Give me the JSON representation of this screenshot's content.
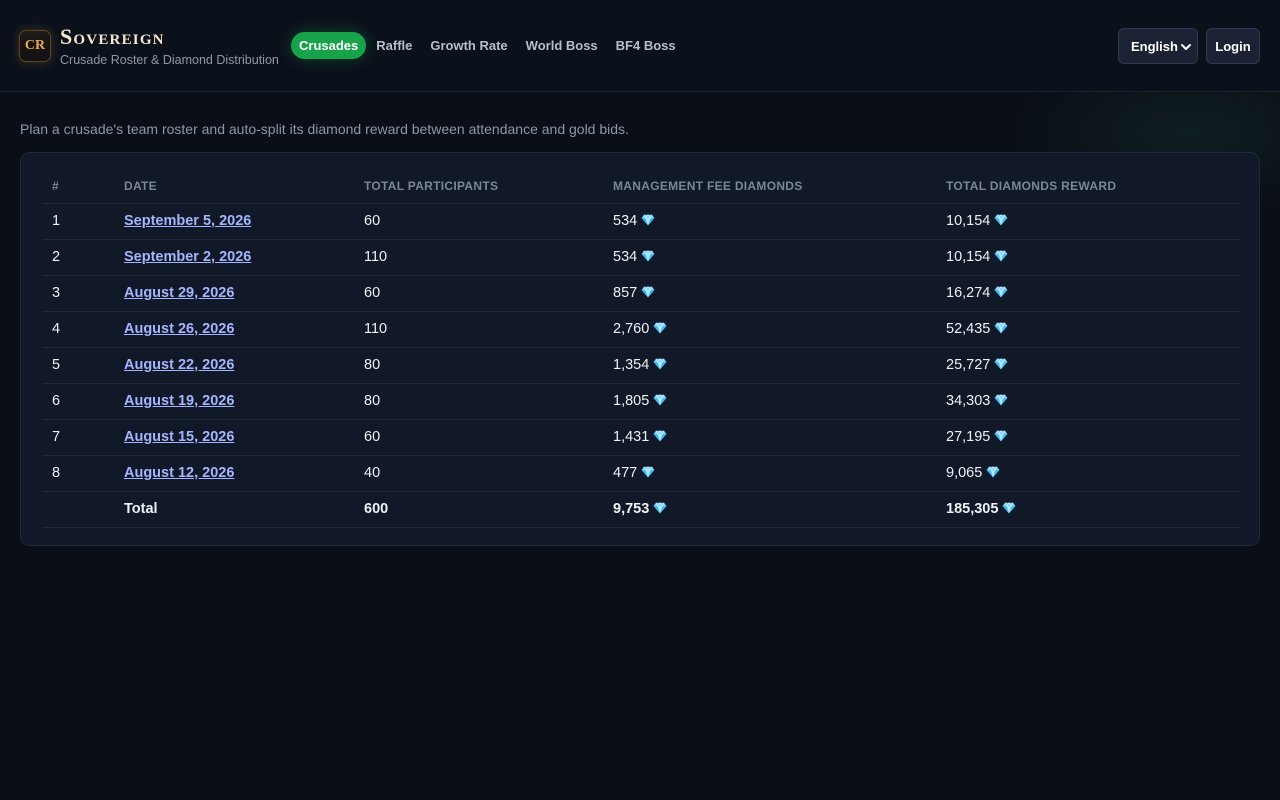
{
  "brand": {
    "badge": "CR",
    "title": "Sovereign",
    "subtitle": "Crusade Roster & Diamond Distribution"
  },
  "nav": [
    {
      "label": "Crusades",
      "active": true
    },
    {
      "label": "Raffle",
      "active": false
    },
    {
      "label": "Growth Rate",
      "active": false
    },
    {
      "label": "World Boss",
      "active": false
    },
    {
      "label": "BF4 Boss",
      "active": false
    }
  ],
  "language": {
    "selected": "English"
  },
  "login_label": "Login",
  "intro": "Plan a crusade's team roster and auto-split its diamond reward between attendance and gold bids.",
  "table": {
    "headers": [
      "#",
      "DATE",
      "TOTAL PARTICIPANTS",
      "MANAGEMENT FEE DIAMONDS",
      "TOTAL DIAMONDS REWARD"
    ],
    "rows": [
      {
        "n": "1",
        "date": "September 5, 2026",
        "participants": "60",
        "fee": "534",
        "reward": "10,154"
      },
      {
        "n": "2",
        "date": "September 2, 2026",
        "participants": "110",
        "fee": "534",
        "reward": "10,154"
      },
      {
        "n": "3",
        "date": "August 29, 2026",
        "participants": "60",
        "fee": "857",
        "reward": "16,274"
      },
      {
        "n": "4",
        "date": "August 26, 2026",
        "participants": "110",
        "fee": "2,760",
        "reward": "52,435"
      },
      {
        "n": "5",
        "date": "August 22, 2026",
        "participants": "80",
        "fee": "1,354",
        "reward": "25,727"
      },
      {
        "n": "6",
        "date": "August 19, 2026",
        "participants": "80",
        "fee": "1,805",
        "reward": "34,303"
      },
      {
        "n": "7",
        "date": "August 15, 2026",
        "participants": "60",
        "fee": "1,431",
        "reward": "27,195"
      },
      {
        "n": "8",
        "date": "August 12, 2026",
        "participants": "40",
        "fee": "477",
        "reward": "9,065"
      }
    ],
    "total": {
      "label": "Total",
      "participants": "600",
      "fee": "9,753",
      "reward": "185,305"
    }
  },
  "icons": {
    "currency": "diamond-icon",
    "dropdown": "chevron-down-icon"
  },
  "colors": {
    "accent": "#16a34a",
    "link": "#a5b4fc",
    "brand_gold": "#e8a955",
    "background": "#0a0e17"
  }
}
